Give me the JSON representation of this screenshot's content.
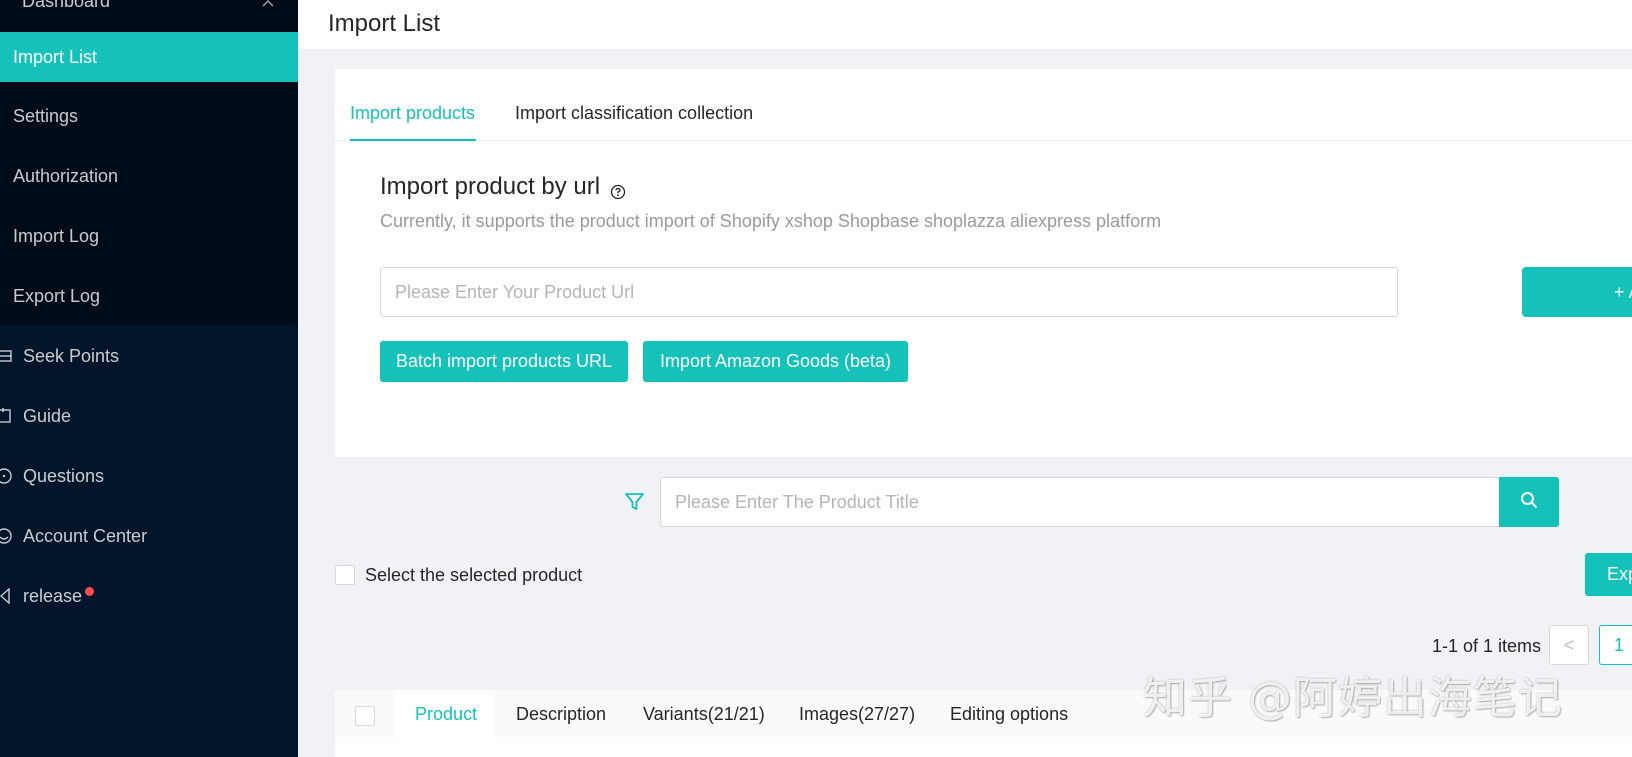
{
  "sidebar": {
    "dashboard_label": "Dashboard",
    "items": [
      {
        "label": "Import List",
        "active": true
      },
      {
        "label": "Settings"
      },
      {
        "label": "Authorization"
      },
      {
        "label": "Import Log"
      },
      {
        "label": "Export Log"
      }
    ],
    "top_items": [
      {
        "label": "Seek Points",
        "icon": "seek-points-icon"
      },
      {
        "label": "Guide",
        "icon": "guide-icon"
      },
      {
        "label": "Questions",
        "icon": "questions-icon"
      },
      {
        "label": "Account Center",
        "icon": "account-center-icon"
      },
      {
        "label": "release",
        "icon": "release-icon",
        "badge_dot": true
      }
    ]
  },
  "header": {
    "title": "Import List"
  },
  "import_card": {
    "tabs": [
      "Import products",
      "Import classification collection"
    ],
    "active_tab": 0,
    "title": "Import product by url",
    "description": "Currently, it supports the product import of Shopify xshop Shopbase shoplazza aliexpress platform",
    "url_placeholder": "Please Enter Your Product Url",
    "add_button_label": "+ A",
    "batch_button_label": "Batch import products URL",
    "amazon_button_label": "Import Amazon Goods (beta)"
  },
  "search": {
    "placeholder": "Please Enter The Product Title"
  },
  "selection": {
    "label": "Select the selected product",
    "export_label": "Exp"
  },
  "pagination": {
    "total_text": "1-1 of 1 items",
    "prev": "<",
    "current_page": "1"
  },
  "product_tabs": [
    "Product",
    "Description",
    "Variants(21/21)",
    "Images(27/27)",
    "Editing options"
  ],
  "watermark": "知乎 @阿婷出海笔记",
  "colors": {
    "accent": "#14c2b9",
    "sidebar_bg": "#001529",
    "submenu_bg": "#000c17",
    "page_bg": "#f0f2f5",
    "badge_red": "#ff4d4f"
  }
}
